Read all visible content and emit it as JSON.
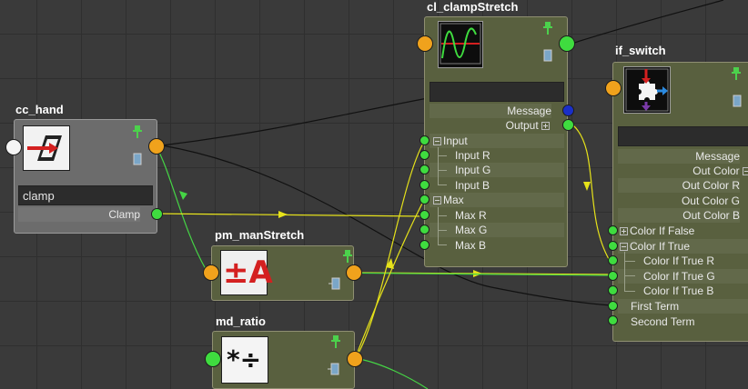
{
  "nodes": {
    "cc_hand": {
      "title": "cc_hand",
      "field_value": "clamp",
      "output_label": "Clamp",
      "icon": "clamp-icon"
    },
    "cl_clampStretch": {
      "title": "cl_clampStretch",
      "message_label": "Message",
      "output_label": "Output",
      "attributes": [
        "Input",
        "Input R",
        "Input G",
        "Input B",
        "Max",
        "Max R",
        "Max G",
        "Max B"
      ],
      "icon": "clamp-curve-icon"
    },
    "if_switch": {
      "title": "if_switch",
      "message_label": "Message",
      "out_color_label": "Out Color",
      "outputs": [
        "Out Color R",
        "Out Color G",
        "Out Color B"
      ],
      "inputs": [
        "Color If False",
        "Color If True",
        "Color If True R",
        "Color If True G",
        "Color If True B",
        "First Term",
        "Second Term"
      ],
      "icon": "condition-icon"
    },
    "pm_manStretch": {
      "title": "pm_manStretch",
      "icon": "plus-minus-average-icon",
      "icon_text": "±A"
    },
    "md_ratio": {
      "title": "md_ratio",
      "icon": "multiply-divide-icon",
      "icon_text": "*÷"
    }
  },
  "colors": {
    "background": "#3a3a3a",
    "grid": "#2f2f2f",
    "grey_node": "#6c6c6c",
    "green_node": "#59603f",
    "port_green": "#3fdc3f",
    "port_orange": "#f0a21c",
    "port_blue": "#1a2fc8",
    "wire_green": "#45d545",
    "wire_yellow": "#e6e21a",
    "wire_black": "#111111"
  }
}
